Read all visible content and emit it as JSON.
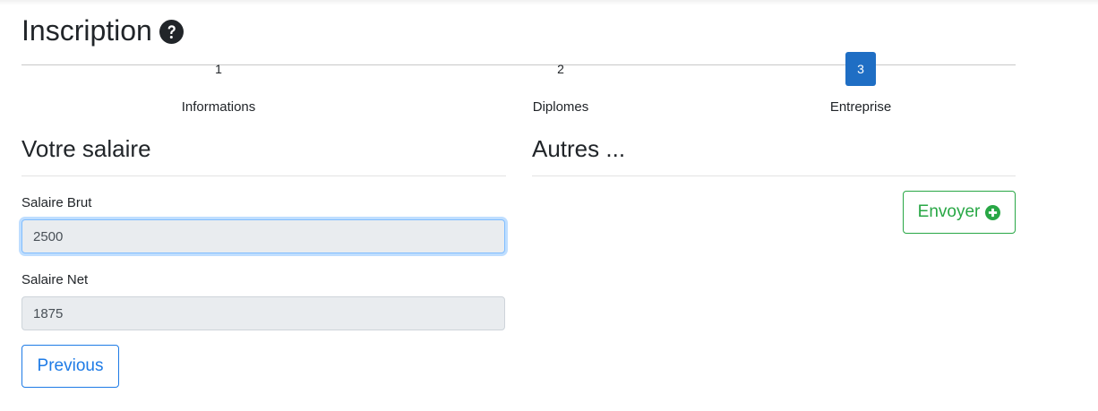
{
  "page": {
    "title": "Inscription",
    "help_icon": "question-circle-icon"
  },
  "stepper": {
    "steps": [
      {
        "number": "1",
        "label": "Informations",
        "active": false
      },
      {
        "number": "2",
        "label": "Diplomes",
        "active": false
      },
      {
        "number": "3",
        "label": "Entreprise",
        "active": true
      }
    ],
    "active_color": "#1f6ec4"
  },
  "salary_section": {
    "heading": "Votre salaire",
    "gross": {
      "label": "Salaire Brut",
      "value": "2500"
    },
    "net": {
      "label": "Salaire Net",
      "value": "1875"
    }
  },
  "other_section": {
    "heading": "Autres ..."
  },
  "buttons": {
    "previous_label": "Previous",
    "previous_color": "#1e7be6",
    "send_label": "Envoyer",
    "send_icon": "plus-circle-icon",
    "send_color": "#28a745"
  }
}
